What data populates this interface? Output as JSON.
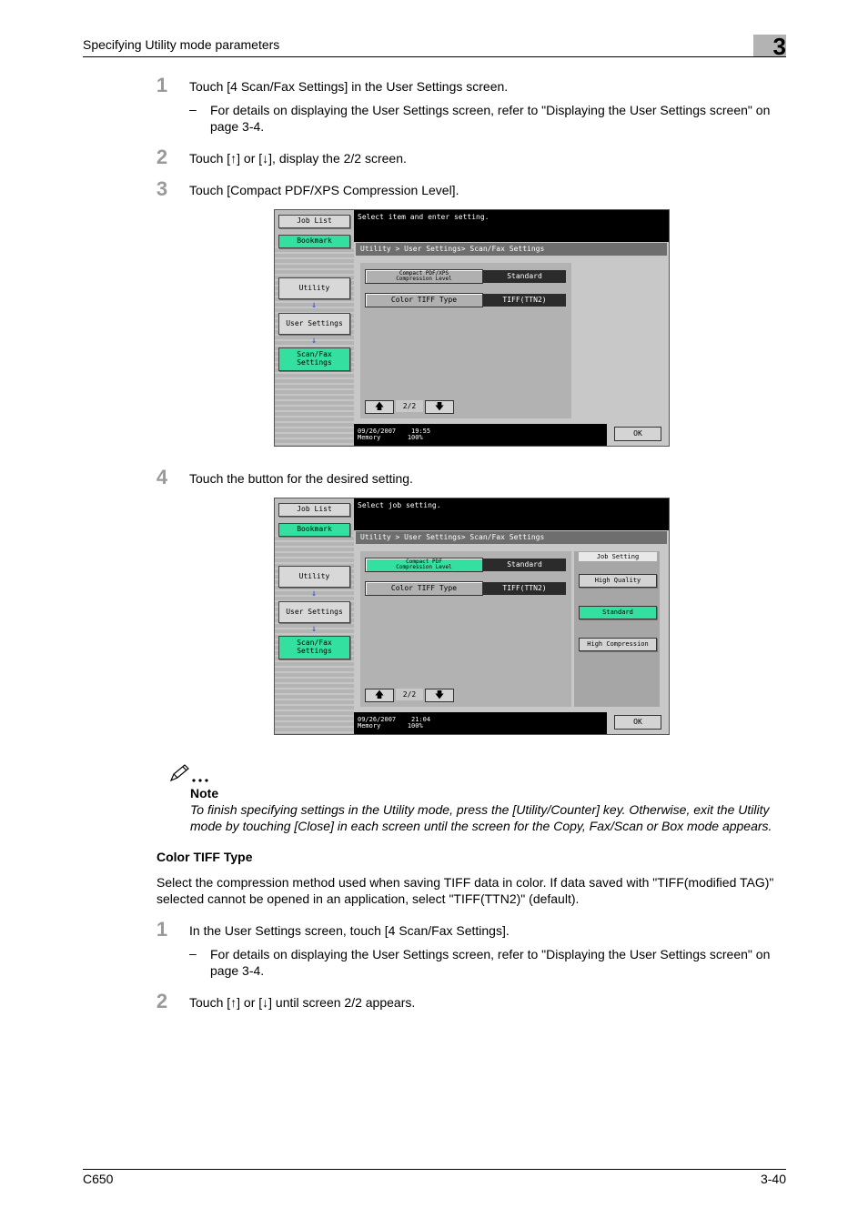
{
  "header": {
    "title": "Specifying Utility mode parameters",
    "chapter": "3"
  },
  "steps_a": [
    {
      "num": "1",
      "text": "Touch [4 Scan/Fax Settings] in the User Settings screen."
    },
    {
      "num": "2",
      "text": "Touch [↑] or [↓], display the 2/2 screen."
    },
    {
      "num": "3",
      "text": "Touch [Compact PDF/XPS Compression Level]."
    },
    {
      "num": "4",
      "text": "Touch the button for the desired setting."
    }
  ],
  "sub_a": {
    "dash": "–",
    "text": "For details on displaying the User Settings screen, refer to \"Displaying the User Settings screen\" on page 3-4."
  },
  "screen": {
    "sidebar": {
      "job_list": "Job List",
      "bookmark": "Bookmark",
      "utility": "Utility",
      "user_settings": "User Settings",
      "scan_fax_1": "Scan/Fax",
      "scan_fax_2": "Settings",
      "arrow": "↓"
    },
    "breadcrumb": "Utility > User Settings> Scan/Fax Settings",
    "item1_label_1": "Compact PDF/XPS",
    "item1_label_2": "Compression Level",
    "item1_label_alt_1": "Compact PDF",
    "item1_label_alt_2": "Compression Level",
    "item1_value": "Standard",
    "item2_label": "Color TIFF Type",
    "item2_value": "TIFF(TTN2)",
    "page": "2/2",
    "up": "🡅",
    "down": "🡇",
    "ok": "OK",
    "screen1_msg": "Select item and enter setting.",
    "screen2_msg": "Select job setting.",
    "screen1_date": "09/26/2007",
    "screen1_time": "19:55",
    "screen2_date": "09/26/2007",
    "screen2_time": "21:04",
    "memory_label": "Memory",
    "memory_value": "100%",
    "job_setting": "Job Setting",
    "high_quality": "High Quality",
    "standard": "Standard",
    "high_compression": "High Compression"
  },
  "note": {
    "label": "Note",
    "text": "To finish specifying settings in the Utility mode, press the [Utility/Counter] key. Otherwise, exit the Utility mode by touching [Close] in each screen until the screen for the Copy, Fax/Scan or Box mode appears."
  },
  "section": {
    "heading": "Color TIFF Type",
    "body": "Select the compression method used when saving TIFF data in color. If data saved with \"TIFF(modified TAG)\" selected cannot be opened in an application, select \"TIFF(TTN2)\" (default).",
    "steps": [
      {
        "num": "1",
        "text": "In the User Settings screen, touch [4 Scan/Fax Settings]."
      },
      {
        "num": "2",
        "text": "Touch [↑] or [↓] until screen 2/2 appears."
      }
    ],
    "sub": {
      "dash": "–",
      "text": "For details on displaying the User Settings screen, refer to \"Displaying the User Settings screen\" on page 3-4."
    }
  },
  "footer": {
    "model": "C650",
    "page": "3-40"
  }
}
